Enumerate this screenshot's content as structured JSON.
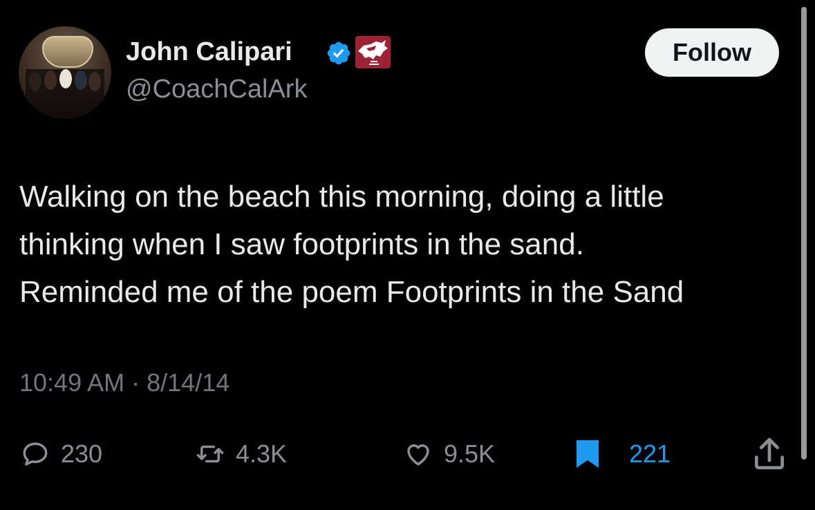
{
  "author": {
    "display_name": "John Calipari",
    "handle": "@CoachCalArk",
    "verified": true,
    "affiliate_badge_color": "#9d2235"
  },
  "follow_button": {
    "label": "Follow"
  },
  "tweet": {
    "lines": [
      "Walking on the beach this morning, doing a little",
      "thinking when I saw footprints in the sand.",
      "Reminded me of the poem Footprints in the Sand"
    ],
    "time": "10:49 AM",
    "separator": "·",
    "date": "8/14/14"
  },
  "actions": {
    "reply": {
      "icon": "reply-icon",
      "count": "230"
    },
    "retweet": {
      "icon": "retweet-icon",
      "count": "4.3K"
    },
    "like": {
      "icon": "heart-icon",
      "count": "9.5K"
    },
    "bookmark": {
      "icon": "bookmark-icon",
      "count": "221",
      "active_color": "#1d9bf0"
    },
    "share": {
      "icon": "share-icon"
    }
  },
  "colors": {
    "background": "#000000",
    "text": "#e7e9ea",
    "secondary": "#71767b",
    "accent": "#1d9bf0"
  }
}
